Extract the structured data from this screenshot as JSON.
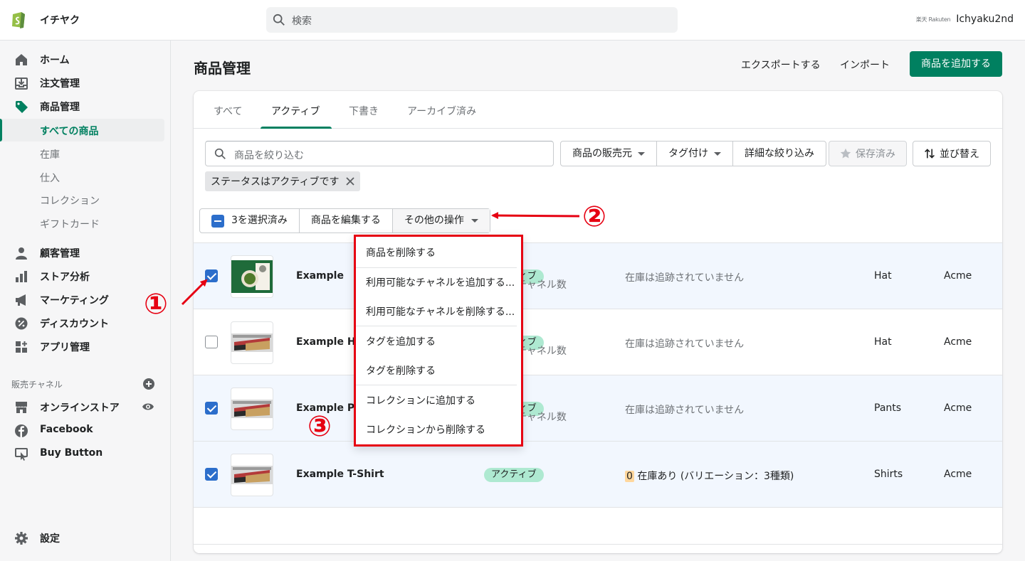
{
  "topbar": {
    "store_name": "イチヤク",
    "search_placeholder": "検索",
    "account_logo_text": "楽天 Rakuten",
    "account_name": "Ichyaku2nd"
  },
  "sidebar": {
    "items": [
      {
        "label": "ホーム",
        "icon": "home-icon"
      },
      {
        "label": "注文管理",
        "icon": "inbox-icon"
      },
      {
        "label": "商品管理",
        "icon": "tag-icon"
      }
    ],
    "product_sub": [
      {
        "label": "すべての商品",
        "active": true
      },
      {
        "label": "在庫"
      },
      {
        "label": "仕入"
      },
      {
        "label": "コレクション"
      },
      {
        "label": "ギフトカード"
      }
    ],
    "items2": [
      {
        "label": "顧客管理",
        "icon": "person-icon"
      },
      {
        "label": "ストア分析",
        "icon": "bar-chart-icon"
      },
      {
        "label": "マーケティング",
        "icon": "megaphone-icon"
      },
      {
        "label": "ディスカウント",
        "icon": "discount-icon"
      },
      {
        "label": "アプリ管理",
        "icon": "apps-icon"
      }
    ],
    "sales_channels_label": "販売チャネル",
    "channels": [
      {
        "label": "オンラインストア",
        "icon": "store-icon"
      },
      {
        "label": "Facebook",
        "icon": "facebook-icon"
      },
      {
        "label": "Buy Button",
        "icon": "buy-button-icon"
      }
    ],
    "settings": "設定"
  },
  "header": {
    "title": "商品管理",
    "export": "エクスポートする",
    "import": "インポート",
    "add_product": "商品を追加する"
  },
  "tabs": [
    "すべて",
    "アクティブ",
    "下書き",
    "アーカイブ済み"
  ],
  "filters": {
    "placeholder": "商品を絞り込む",
    "vendor": "商品の販売元",
    "tagged": "タグ付け",
    "more_filters": "詳細な絞り込み",
    "saved": "保存済み",
    "sort": "並び替え",
    "chip": "ステータスはアクティブです"
  },
  "bulk": {
    "selected": "3を選択済み",
    "edit": "商品を編集する",
    "more_actions": "その他の操作"
  },
  "rows": [
    {
      "name": "Example",
      "status": "アクティブ",
      "channels": "チャネル数",
      "inventory": "在庫は追跡されていません",
      "type": "Hat",
      "vendor": "Acme",
      "selected": true
    },
    {
      "name": "Example Hat",
      "status": "アクティブ",
      "channels": "チャネル数",
      "inventory": "在庫は追跡されていません",
      "type": "Hat",
      "vendor": "Acme",
      "selected": false
    },
    {
      "name": "Example Pants",
      "status": "アクティブ",
      "channels": "チャネル数",
      "inventory": "在庫は追跡されていません",
      "type": "Pants",
      "vendor": "Acme",
      "selected": true
    },
    {
      "name": "Example T-Shirt",
      "status": "アクティブ",
      "channels": "",
      "inventory_zero": "0",
      "inventory": " 在庫あり (バリエーション：3種類)",
      "type": "Shirts",
      "vendor": "Acme",
      "selected": true
    }
  ],
  "dropdown": [
    "商品を削除する",
    "利用可能なチャネルを追加する...",
    "利用可能なチャネルを削除する...",
    "タグを追加する",
    "タグを削除する",
    "コレクションに追加する",
    "コレクションから削除する"
  ],
  "annotations": [
    "①",
    "②",
    "③"
  ],
  "colors": {
    "accent": "#008060",
    "annotation": "#e60012",
    "selected_row": "#f2f7fe",
    "status_badge": "#aee9d1"
  }
}
